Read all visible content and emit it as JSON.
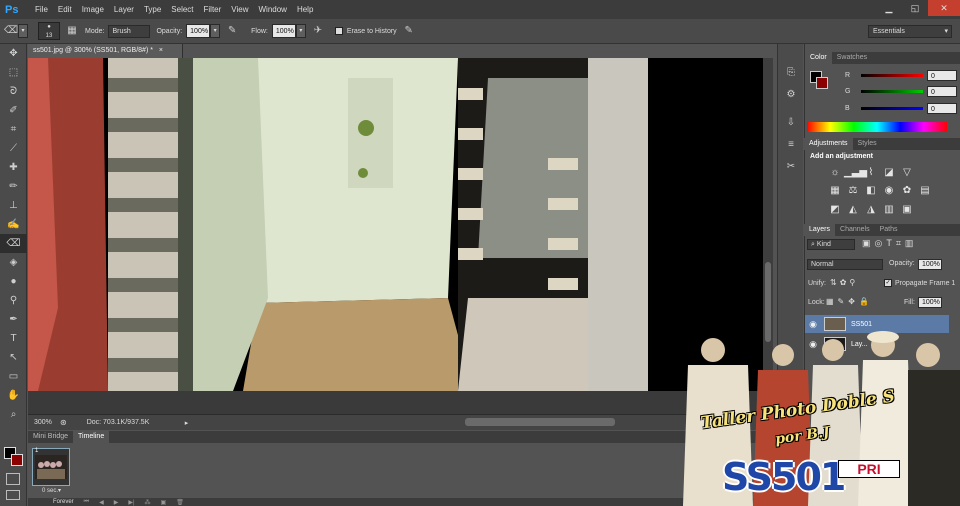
{
  "app": {
    "logo": "Ps"
  },
  "menu": [
    "File",
    "Edit",
    "Image",
    "Layer",
    "Type",
    "Select",
    "Filter",
    "View",
    "Window",
    "Help"
  ],
  "window_controls": {
    "minimize": "▁",
    "restore": "◱",
    "close": "✕"
  },
  "options": {
    "brush_size": "13",
    "mode_label": "Mode:",
    "mode_value": "Brush",
    "opacity_label": "Opacity:",
    "opacity_value": "100%",
    "flow_label": "Flow:",
    "flow_value": "100%",
    "erase_history_label": "Erase to History",
    "workspace": "Essentials"
  },
  "document": {
    "tab_title": "ss501.jpg @ 300% (SS501, RGB/8#) *",
    "close": "×",
    "zoom": "300%",
    "doc_info": "Doc: 703.1K/937.5K"
  },
  "bottom_tabs": [
    "Mini Bridge",
    "Timeline"
  ],
  "timeline": {
    "frame_number": "1",
    "frame_delay": "0 sec.▾",
    "loop": "Forever"
  },
  "color_panel": {
    "tabs": [
      "Color",
      "Swatches"
    ],
    "channels": [
      {
        "name": "R",
        "value": "0",
        "color": "#ff0000"
      },
      {
        "name": "G",
        "value": "0",
        "color": "#00cc00"
      },
      {
        "name": "B",
        "value": "0",
        "color": "#0000ff"
      }
    ]
  },
  "adjustments": {
    "tabs": [
      "Adjustments",
      "Styles"
    ],
    "heading": "Add an adjustment"
  },
  "layers": {
    "tabs": [
      "Layers",
      "Channels",
      "Paths"
    ],
    "kind_label": "Kind",
    "blend_mode": "Normal",
    "opacity_label": "Opacity:",
    "opacity_value": "100%",
    "unify_label": "Unify:",
    "propagate_label": "Propagate Frame 1",
    "lock_label": "Lock:",
    "fill_label": "Fill:",
    "fill_value": "100%",
    "items": [
      {
        "name": "SS501"
      },
      {
        "name": "Lay..."
      }
    ]
  },
  "watermark": {
    "line1": "Taller Photo Doble S",
    "line2": "por B.J",
    "logo": "SS501",
    "badge": "PRI"
  }
}
